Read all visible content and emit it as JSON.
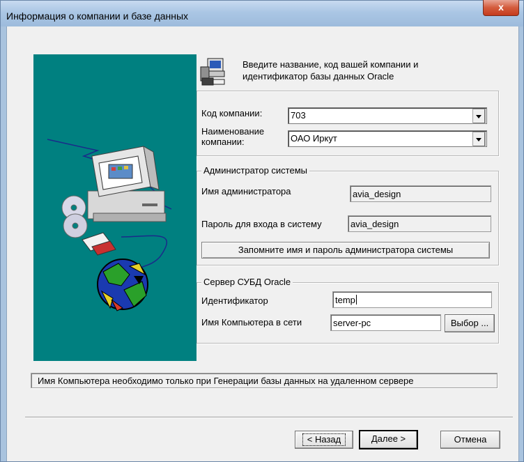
{
  "window": {
    "title": "Информация о компании и базе данных",
    "close_glyph": "x"
  },
  "header": {
    "line1": "Введите название, код вашей компании и",
    "line2": "идентификатор базы данных Oracle"
  },
  "company": {
    "code_label": "Код компании:",
    "code_value": "703",
    "name_label_line1": "Наименование",
    "name_label_line2": "компании:",
    "name_value": "ОАО Иркут"
  },
  "admin": {
    "group_label": "Администратор системы",
    "name_label": "Имя администратора",
    "name_value": "avia_design",
    "password_label": "Пароль для входа в систему",
    "password_value": "avia_design",
    "remember_button": "Запомните имя и пароль администратора системы"
  },
  "server": {
    "group_label": "Сервер СУБД Oracle",
    "id_label": "Идентификатор",
    "id_value": "temp",
    "host_label": "Имя Компьютера в сети",
    "host_value": "server-pc",
    "browse_button": "Выбор ..."
  },
  "status_text": "Имя Компьютера необходимо только при Генерации базы данных на удаленном сервере",
  "buttons": {
    "back": "< Назад",
    "next": "Далее >",
    "cancel": "Отмена"
  },
  "icons": [
    "computer-install-icon",
    "computer-globe-illustration",
    "close-icon",
    "dropdown-arrow-icon"
  ],
  "colors": {
    "art_background": "#008080",
    "title_bar": "#aac6e4",
    "close_button": "#c43a1d",
    "dialog_face": "#f0f0f0"
  }
}
